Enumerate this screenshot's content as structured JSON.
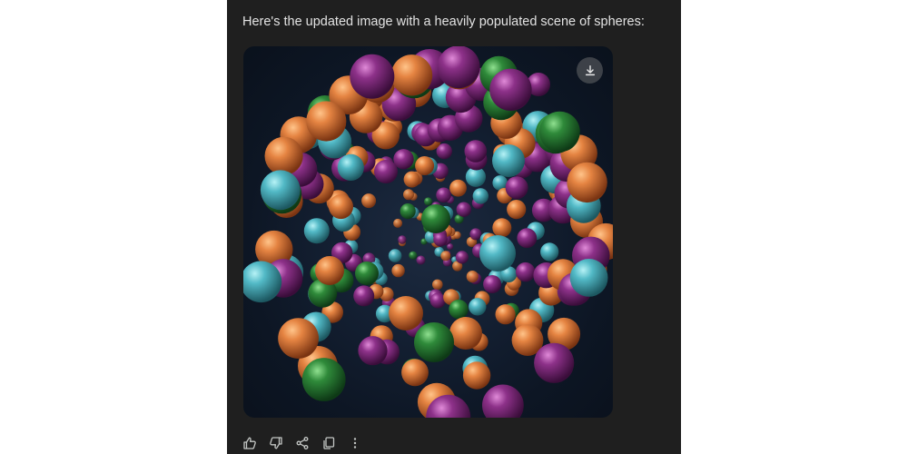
{
  "message": {
    "text": "Here's the updated image with a heavily populated scene of spheres:"
  },
  "image": {
    "download_icon": "download-icon",
    "palette": {
      "orange": "#d8733a",
      "teal": "#4fb6c2",
      "purple": "#8a2f86",
      "green": "#2f8a3a",
      "background": "#0d1624"
    }
  },
  "actions": {
    "icons": [
      "thumbs-up-icon",
      "thumbs-down-icon",
      "share-icon",
      "copy-icon",
      "more-vert-icon"
    ]
  }
}
